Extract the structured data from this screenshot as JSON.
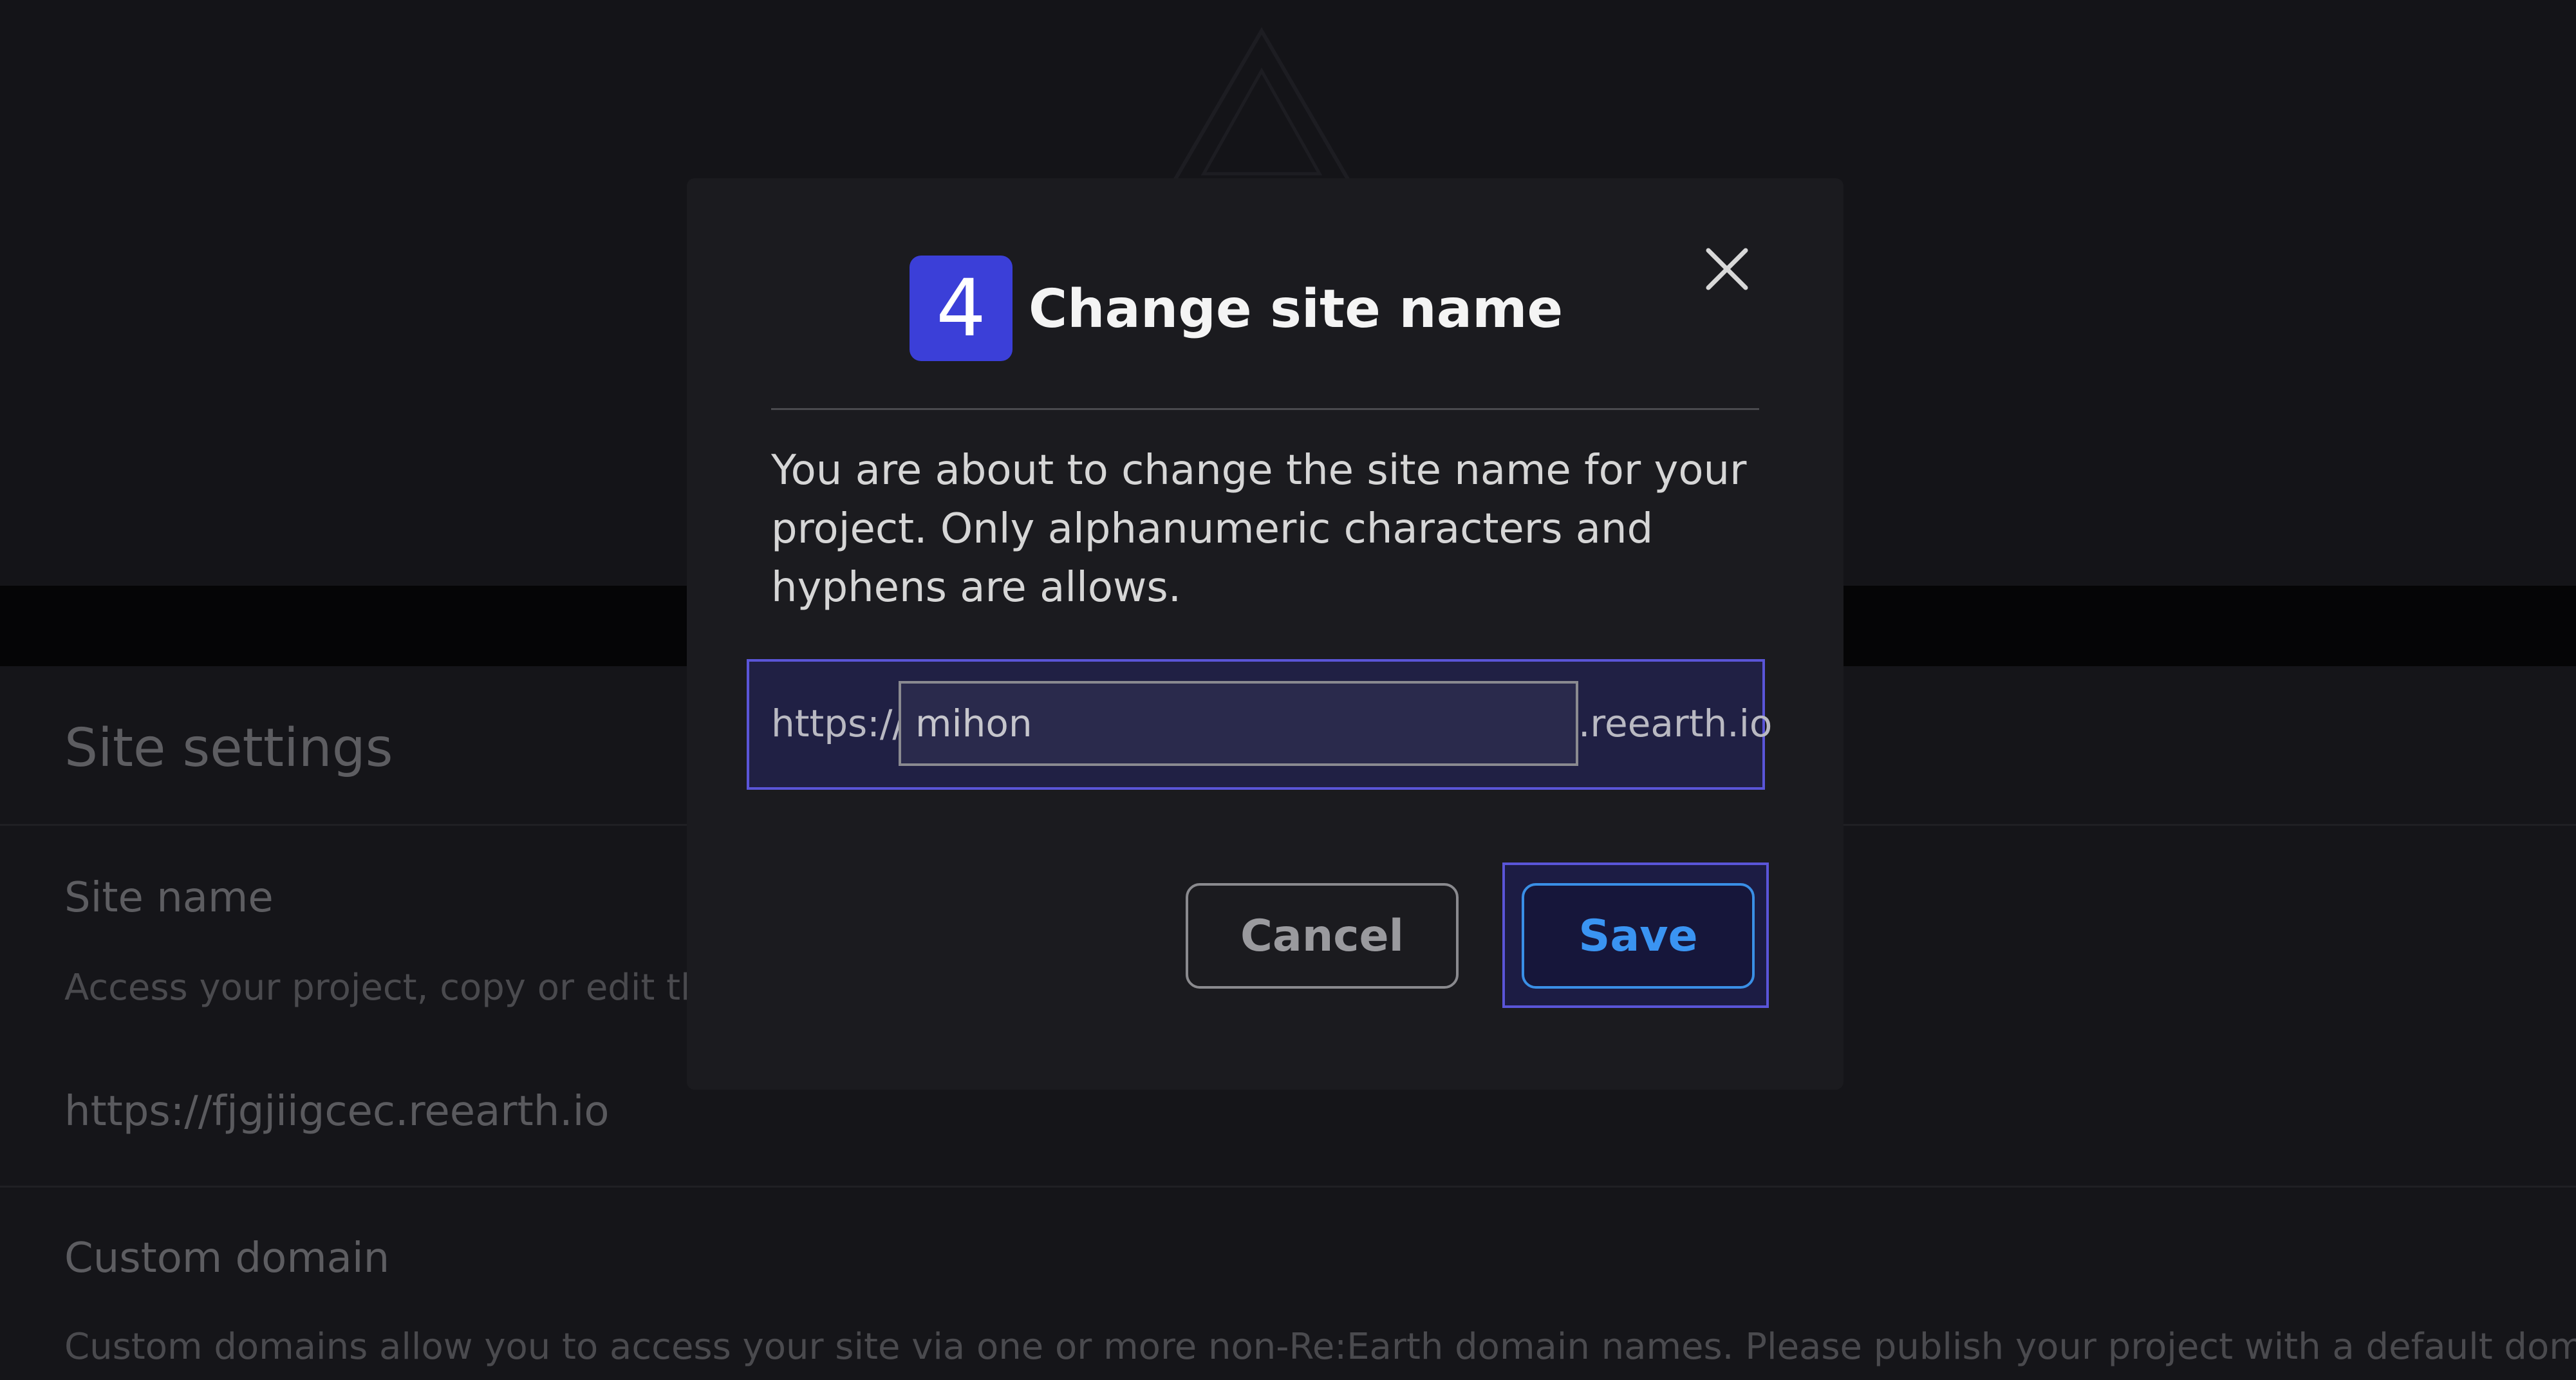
{
  "background": {
    "settings_title": "Site settings",
    "site_name_section": {
      "label": "Site name",
      "description": "Access your project, copy or edit the",
      "url": "https://fjgjiigcec.reearth.io"
    },
    "custom_domain_section": {
      "label": "Custom domain",
      "description": "Custom domains allow you to access your site via one or more non-Re:Earth domain names. Please publish your project with a default domain be"
    }
  },
  "modal": {
    "step_number": "4",
    "title": "Change site name",
    "close_icon": "close-icon",
    "message": "You are about to change the site name for your project. Only alphanumeric characters and hyphens are allows.",
    "url_prefix": "https://",
    "site_name_value": "mihon",
    "url_suffix": ".reearth.io",
    "cancel_label": "Cancel",
    "save_label": "Save"
  },
  "colors": {
    "accent_badge": "#3b3fd8",
    "focus_outline": "#5a55d8",
    "save_text": "#3a94f2"
  }
}
